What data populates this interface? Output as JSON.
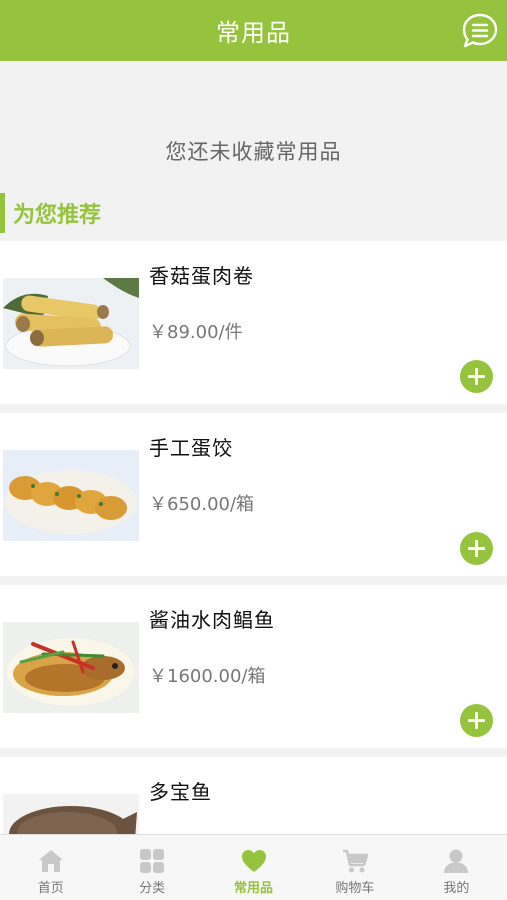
{
  "header": {
    "title": "常用品"
  },
  "empty_state": {
    "text": "您还未收藏常用品"
  },
  "section": {
    "title": "为您推荐"
  },
  "products": [
    {
      "name": "香菇蛋肉卷",
      "price": "￥89.00/件",
      "image": "egg-roll-photo"
    },
    {
      "name": "手工蛋饺",
      "price": "￥650.00/箱",
      "image": "egg-dumpling-photo"
    },
    {
      "name": "酱油水肉鲳鱼",
      "price": "￥1600.00/箱",
      "image": "soy-pomfret-photo"
    },
    {
      "name": "多宝鱼",
      "price": "",
      "image": "turbot-photo"
    }
  ],
  "tabs": [
    {
      "label": "首页",
      "icon": "home-icon",
      "active": false
    },
    {
      "label": "分类",
      "icon": "grid-icon",
      "active": false
    },
    {
      "label": "常用品",
      "icon": "heart-icon",
      "active": true
    },
    {
      "label": "购物车",
      "icon": "cart-icon",
      "active": false
    },
    {
      "label": "我的",
      "icon": "user-icon",
      "active": false
    }
  ],
  "colors": {
    "accent": "#96c33d",
    "tab_inactive": "#c8c8c8"
  }
}
